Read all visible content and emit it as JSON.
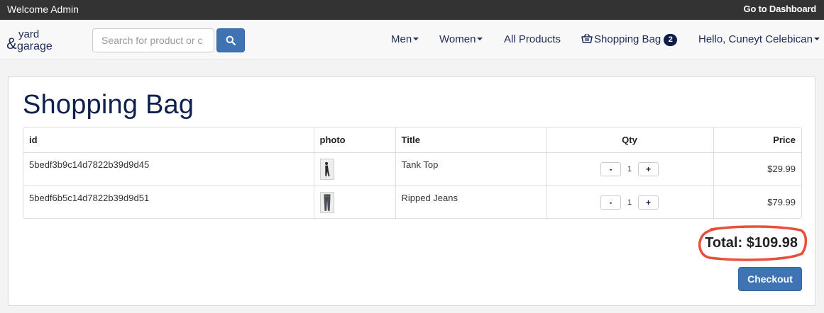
{
  "topbar": {
    "welcome": "Welcome Admin",
    "dashboard_link": "Go to Dashboard"
  },
  "nav": {
    "logo_text": "yard & garage",
    "search_placeholder": "Search for product or c",
    "men": "Men",
    "women": "Women",
    "all_products": "All Products",
    "shopping_bag": "Shopping Bag",
    "bag_count": "2",
    "user_greeting": "Hello, Cuneyt Celebican"
  },
  "page": {
    "title": "Shopping Bag"
  },
  "table": {
    "headers": {
      "id": "id",
      "photo": "photo",
      "title": "Title",
      "qty": "Qty",
      "price": "Price"
    },
    "rows": [
      {
        "id": "5bedf3b9c14d7822b39d9d45",
        "title": "Tank Top",
        "qty": "1",
        "price": "$29.99"
      },
      {
        "id": "5bedf6b5c14d7822b39d9d51",
        "title": "Ripped Jeans",
        "qty": "1",
        "price": "$79.99"
      }
    ],
    "minus_label": "-",
    "plus_label": "+"
  },
  "summary": {
    "total": "Total: $109.98",
    "checkout_label": "Checkout"
  },
  "colors": {
    "topbar": "#333333",
    "primary": "#3e74b4",
    "title": "#10204e",
    "highlight": "#e8503a"
  },
  "icons": {
    "search": "search-icon",
    "basket": "basket-icon"
  }
}
